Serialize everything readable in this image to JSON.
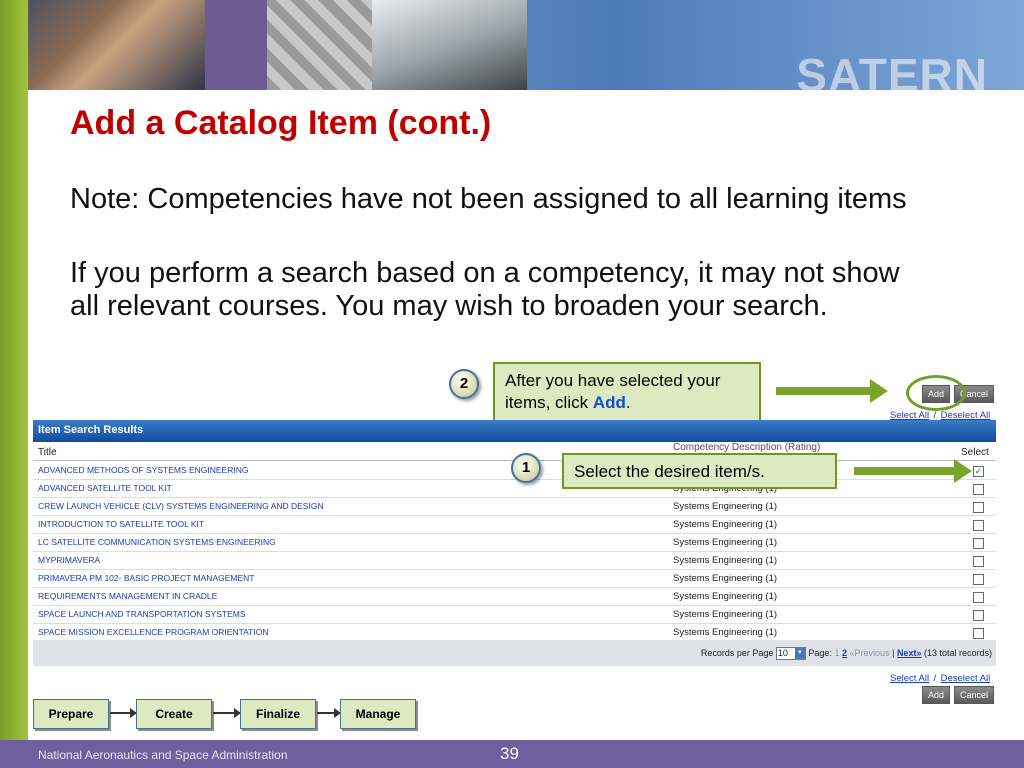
{
  "banner": {
    "brand_word": "SATERN"
  },
  "slide": {
    "title": "Add a Catalog Item (cont.)",
    "note": "Note: Competencies have not been assigned to all learning items",
    "paragraph": "If you perform a search based on a competency, it may not show all relevant courses. You may wish to broaden your search.",
    "page_number": "39",
    "footer": "National Aeronautics and Space Administration"
  },
  "callouts": {
    "step2": {
      "badge": "2",
      "text_before": "After you have selected your items, click ",
      "emphasis": "Add",
      "text_after": "."
    },
    "step1": {
      "badge": "1",
      "text": "Select the desired item/s."
    }
  },
  "actions": {
    "add_label": "Add",
    "cancel_label": "Cancel",
    "select_all": "Select All",
    "separator": "/",
    "deselect_all": "Deselect All"
  },
  "results": {
    "heading": "Item Search Results",
    "columns": {
      "title": "Title",
      "competency": "Competency Description (Rating)",
      "select": "Select"
    },
    "rows": [
      {
        "title": "ADVANCED METHODS OF SYSTEMS ENGINEERING",
        "competency": "",
        "selected": true
      },
      {
        "title": "ADVANCED SATELLITE TOOL KIT",
        "competency": "Systems Engineering (1)",
        "selected": false
      },
      {
        "title": "CREW LAUNCH VEHICLE (CLV) SYSTEMS ENGINEERING AND DESIGN",
        "competency": "Systems Engineering (1)",
        "selected": false
      },
      {
        "title": "INTRODUCTION TO SATELLITE TOOL KIT",
        "competency": "Systems Engineering (1)",
        "selected": false
      },
      {
        "title": "LC SATELLITE COMMUNICATION SYSTEMS ENGINEERING",
        "competency": "Systems Engineering (1)",
        "selected": false
      },
      {
        "title": "MYPRIMAVERA",
        "competency": "Systems Engineering (1)",
        "selected": false
      },
      {
        "title": "PRIMAVERA PM 102- BASIC PROJECT MANAGEMENT",
        "competency": "Systems Engineering (1)",
        "selected": false
      },
      {
        "title": "REQUIREMENTS MANAGEMENT IN CRADLE",
        "competency": "Systems Engineering (1)",
        "selected": false
      },
      {
        "title": "SPACE LAUNCH AND TRANSPORTATION SYSTEMS",
        "competency": "Systems Engineering (1)",
        "selected": false
      },
      {
        "title": "SPACE MISSION EXCELLENCE PROGRAM ORIENTATION",
        "competency": "Systems Engineering (1)",
        "selected": false
      }
    ],
    "pager": {
      "records_per_page_label": "Records per Page",
      "records_per_page_value": "10",
      "page_label": "Page:",
      "page_1": "1",
      "page_2": "2",
      "previous": "«Previous",
      "divider": "|",
      "next": "Next»",
      "total": "(13 total records)"
    }
  },
  "flow": {
    "steps": [
      "Prepare",
      "Create",
      "Finalize",
      "Manage"
    ]
  },
  "colors": {
    "title_red": "#c00000",
    "callout_fill": "#dde9c0",
    "callout_border": "#6b9a1e",
    "header_blue": "#0f4d9c",
    "footer_purple": "#6e5f9e",
    "link_blue": "#1a3fb0"
  }
}
